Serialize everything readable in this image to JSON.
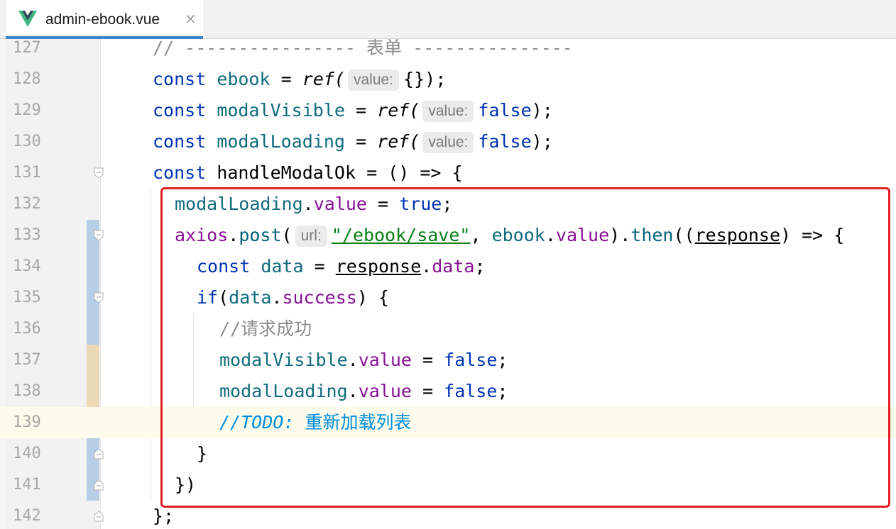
{
  "tab": {
    "filename": "admin-ebook.vue",
    "close_glyph": "×",
    "icon": "vue-logo-icon"
  },
  "colors": {
    "keyword": "#0033b3",
    "variable": "#0f6b7c",
    "property": "#871094",
    "string": "#067d17",
    "comment": "#8c8c8c",
    "todo": "#008dde",
    "highlight_box": "#e02020"
  },
  "lines": [
    {
      "num": "127",
      "tokens": [
        "// ---------------- 表单 ---------------"
      ]
    },
    {
      "num": "128",
      "tokens": [
        "const",
        "ebook",
        "=",
        "ref(",
        "value:",
        "{});"
      ]
    },
    {
      "num": "129",
      "tokens": [
        "const",
        "modalVisible",
        "=",
        "ref(",
        "value:",
        "false",
        ");"
      ]
    },
    {
      "num": "130",
      "tokens": [
        "const",
        "modalLoading",
        "=",
        "ref(",
        "value:",
        "false",
        ");"
      ]
    },
    {
      "num": "131",
      "tokens": [
        "const",
        "handleModalOk",
        "= () => {"
      ]
    },
    {
      "num": "132",
      "tokens": [
        "modalLoading",
        ".",
        "value",
        "=",
        "true",
        ";"
      ]
    },
    {
      "num": "133",
      "tokens": [
        "axios",
        ".",
        "post",
        "(",
        "url:",
        "\"/ebook/save\"",
        ", ",
        "ebook",
        ".",
        "value",
        ").",
        "then",
        "((",
        "response",
        ") => {"
      ]
    },
    {
      "num": "134",
      "tokens": [
        "const",
        "data",
        "=",
        "response",
        ".",
        "data",
        ";"
      ]
    },
    {
      "num": "135",
      "tokens": [
        "if",
        "(",
        "data",
        ".",
        "success",
        ") {"
      ]
    },
    {
      "num": "136",
      "tokens": [
        "//请求成功"
      ]
    },
    {
      "num": "137",
      "tokens": [
        "modalVisible",
        ".",
        "value",
        "=",
        "false",
        ";"
      ]
    },
    {
      "num": "138",
      "tokens": [
        "modalLoading",
        ".",
        "value",
        "=",
        "false",
        ";"
      ]
    },
    {
      "num": "139",
      "tokens": [
        "//",
        "TODO:",
        "重新加载列表"
      ]
    },
    {
      "num": "140",
      "tokens": [
        "}"
      ]
    },
    {
      "num": "141",
      "tokens": [
        "})"
      ]
    },
    {
      "num": "142",
      "tokens": [
        "};"
      ]
    }
  ]
}
